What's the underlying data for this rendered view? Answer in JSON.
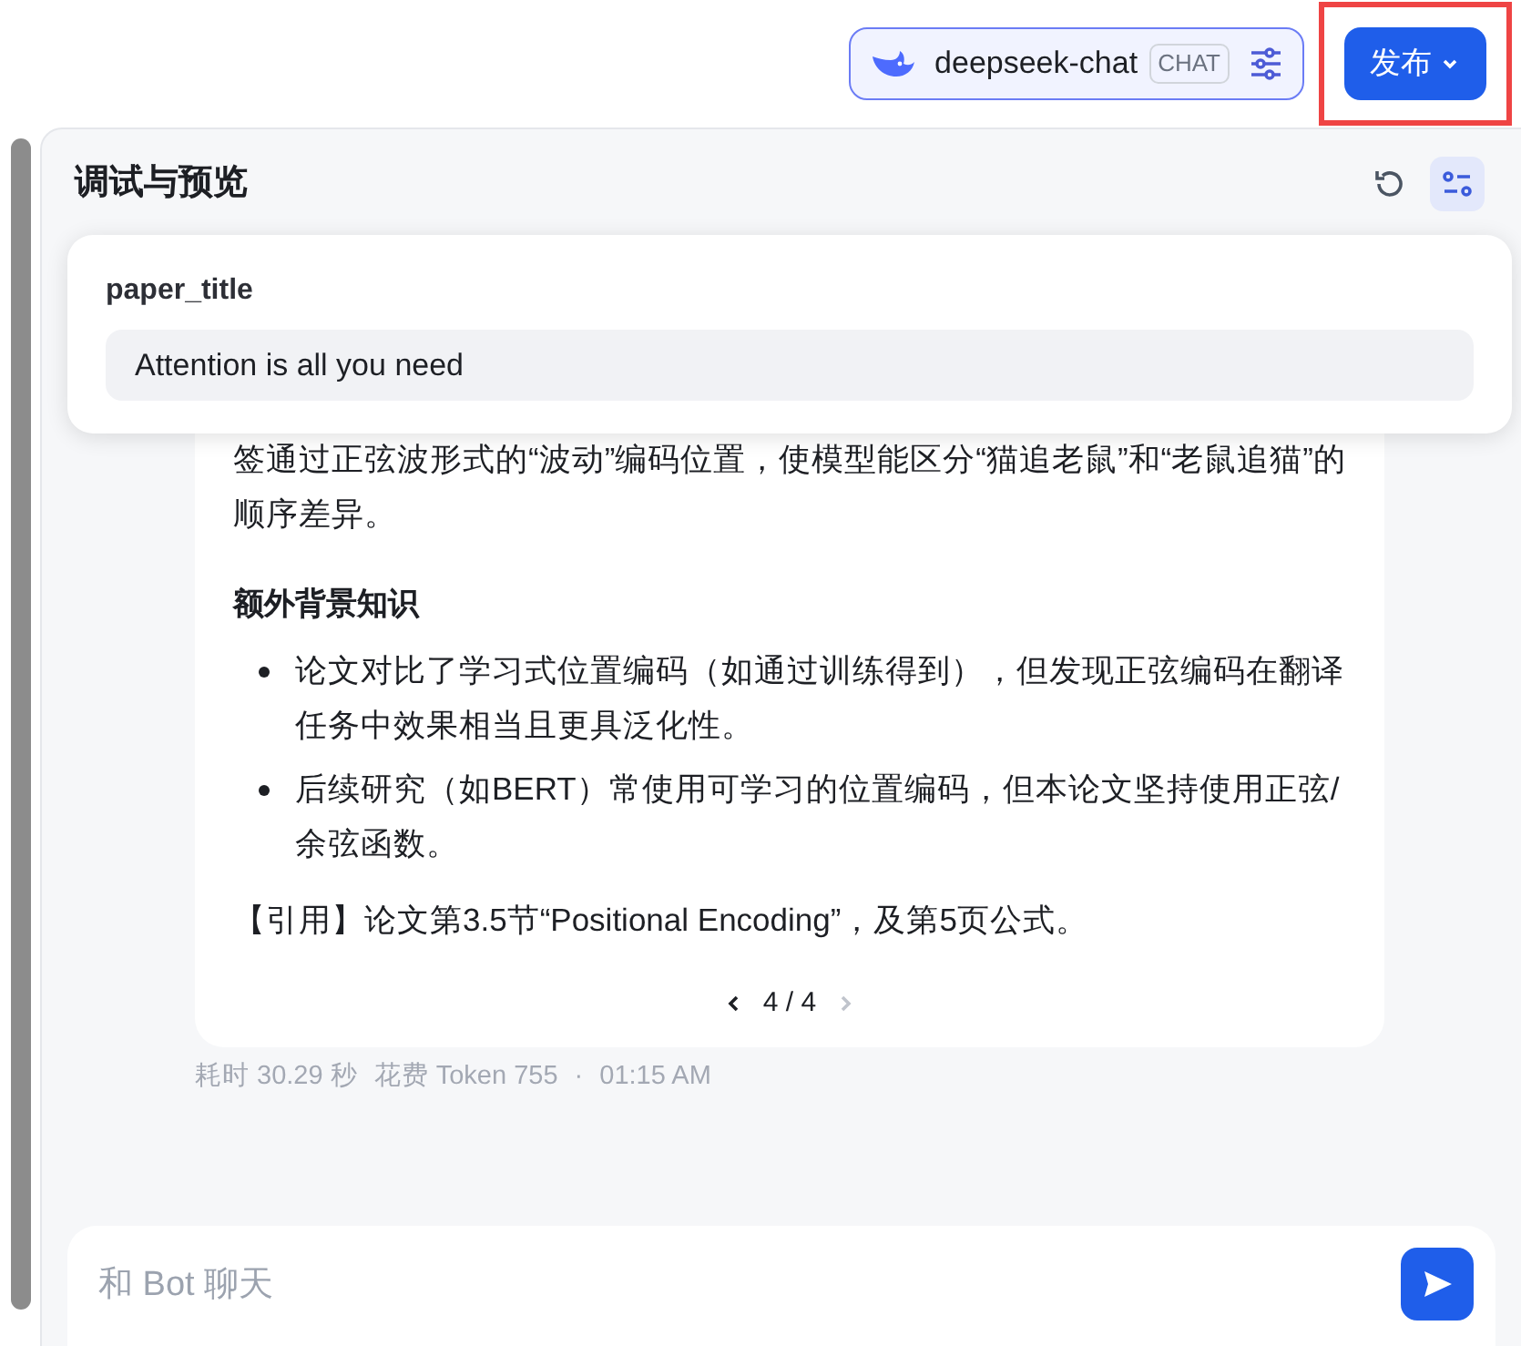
{
  "header": {
    "model": {
      "name": "deepseek-chat",
      "tag": "CHAT"
    },
    "publish_button": {
      "label": "发布",
      "highlighted": true
    }
  },
  "panel": {
    "title": "调试与预览"
  },
  "variables_popup": {
    "fields": [
      {
        "label": "paper_title",
        "value": "Attention is all you need"
      }
    ]
  },
  "message": {
    "blocks": [
      {
        "kind": "paragraph",
        "text": "签通过正弦波形式的“波动”编码位置，使模型能区分“猫追老鼠”和“老鼠追猫”的顺序差异。"
      },
      {
        "kind": "heading",
        "text": "额外背景知识"
      },
      {
        "kind": "bullets",
        "items": [
          "论文对比了学习式位置编码（如通过训练得到），但发现正弦编码在翻译任务中效果相当且更具泛化性。",
          "后续研究（如BERT）常使用可学习的位置编码，但本论文坚持使用正弦/余弦函数。"
        ]
      },
      {
        "kind": "paragraph",
        "text": "【引用】论文第3.5节“Positional Encoding”，及第5页公式。"
      }
    ],
    "pager": {
      "text": "4 / 4",
      "prev_disabled": false,
      "next_disabled": true
    },
    "meta": [
      "耗时 30.29 秒",
      "花费 Token 755",
      "·",
      "01:15 AM"
    ]
  },
  "composer": {
    "placeholder": "和 Bot 聊天"
  }
}
